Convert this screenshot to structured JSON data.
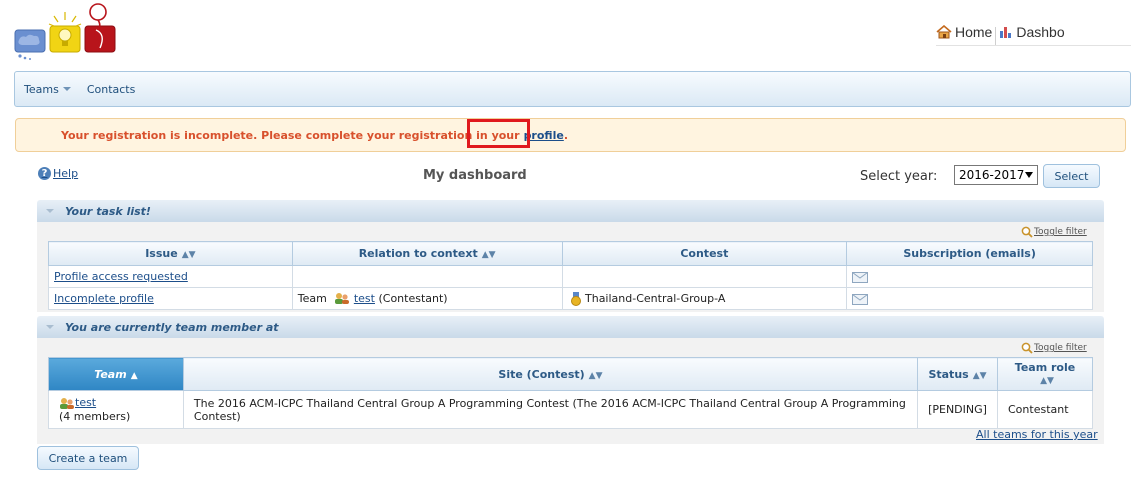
{
  "header": {
    "nav": [
      {
        "label": "Home",
        "icon": "home-icon"
      },
      {
        "label": "Dashbo",
        "icon": "chart-icon"
      }
    ]
  },
  "menubar": {
    "items": [
      {
        "label": "Teams",
        "has_dropdown": true
      },
      {
        "label": "Contacts",
        "has_dropdown": false
      }
    ]
  },
  "banner": {
    "message": "Your registration is incomplete. Please complete your registration in your",
    "link_label": "profile",
    "trail": "."
  },
  "dashboard": {
    "help_label": "Help",
    "title": "My dashboard",
    "year_label": "Select year:",
    "year_value": "2016-2017",
    "select_button": "Select"
  },
  "task_list": {
    "title": "Your task list!",
    "toggle_filter": "Toggle filter",
    "columns": [
      "Issue",
      "Relation to context",
      "Contest",
      "Subscription (emails)"
    ],
    "rows": [
      {
        "issue": "Profile access requested",
        "relation_prefix": "",
        "relation_link": "",
        "relation_suffix": "",
        "contest": ""
      },
      {
        "issue": "Incomplete profile",
        "relation_prefix": "Team",
        "relation_link": "test",
        "relation_suffix": "(Contestant)",
        "contest": "Thailand-Central-Group-A"
      }
    ]
  },
  "team_member": {
    "title": "You are currently team member at",
    "toggle_filter": "Toggle filter",
    "columns": [
      "Team",
      "Site (Contest)",
      "Status",
      "Team role"
    ],
    "rows": [
      {
        "team": "test",
        "members": "(4 members)",
        "site": "The 2016 ACM-ICPC Thailand Central Group A Programming Contest (The 2016 ACM-ICPC Thailand Central Group A Programming Contest)",
        "status": "[PENDING]",
        "role": "Contestant"
      }
    ],
    "all_teams_link": "All teams for this year"
  },
  "create_team_button": "Create a team",
  "colors": {
    "accent": "#2f86c4",
    "banner_text": "#d8502c",
    "banner_bg": "#fff4e0",
    "highlight": "#e0191e",
    "link": "#1c4e8a"
  }
}
